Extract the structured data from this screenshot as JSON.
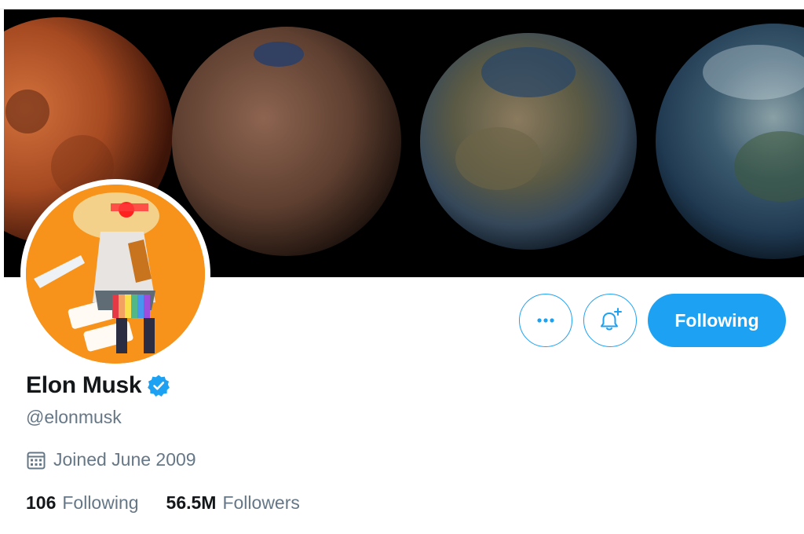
{
  "profile": {
    "display_name": "Elon Musk",
    "handle": "@elonmusk",
    "verified": true,
    "joined": "Joined June 2009"
  },
  "stats": {
    "following_count": "106",
    "following_label": "Following",
    "followers_count": "56.5M",
    "followers_label": "Followers"
  },
  "actions": {
    "more_icon": "more-horizontal-icon",
    "notify_icon": "bell-plus-icon",
    "follow_button_label": "Following"
  },
  "icons": {
    "verified": "verified-badge-icon",
    "calendar": "calendar-icon"
  },
  "colors": {
    "accent": "#1da1f2",
    "text_primary": "#14171a",
    "text_secondary": "#657786",
    "avatar_bg": "#f7931a",
    "banner_bg": "#000000"
  }
}
